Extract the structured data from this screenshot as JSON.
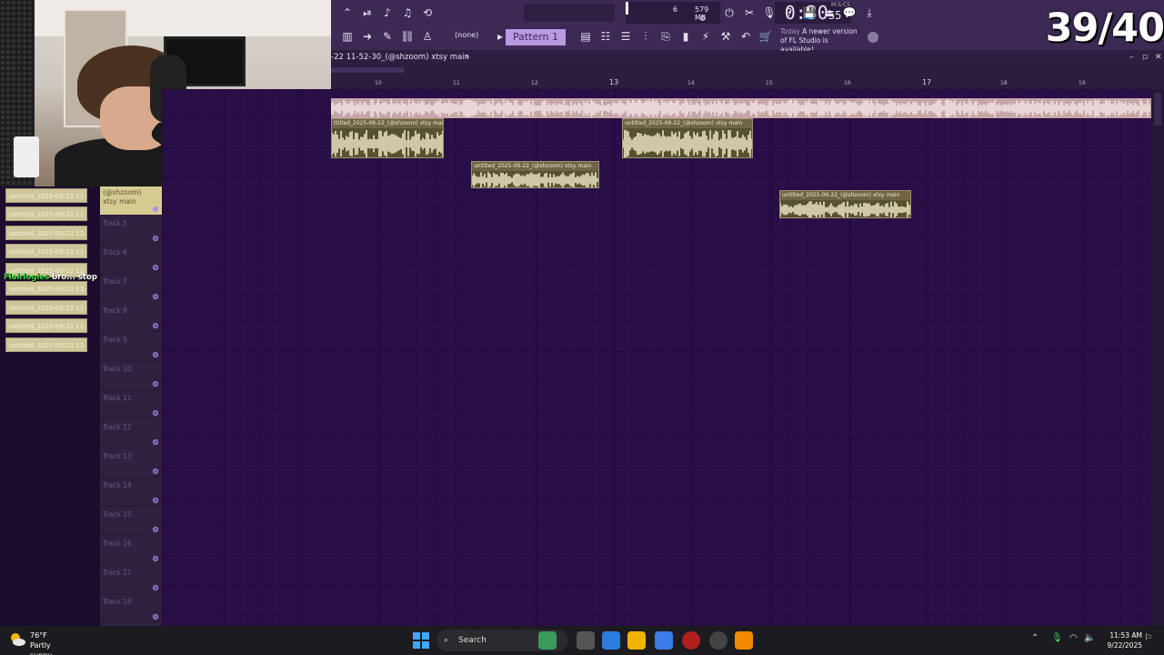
{
  "counter": "39/40",
  "toolbar": {
    "time_main": "0:30",
    "time_sub": "55",
    "time_unit": "M:S:CS",
    "cpu_value": "6",
    "ram_value": "579 MB",
    "voice_value": "0",
    "pattern_label": "Pattern 1",
    "snap_label": "(none)",
    "news_when": "Today",
    "news_text": "A newer version of FL Studio is available!"
  },
  "playlist": {
    "title": "-22 11-52-30_(@shzoom) xtsy main",
    "title_arrow": "›",
    "ruler": [
      "10",
      "11",
      "12",
      "13",
      "14",
      "15",
      "16",
      "17",
      "18",
      "19"
    ],
    "clips": [
      {
        "label": "ttitled_2025-09-22_(@shzoom) xtsy main"
      },
      {
        "label": "untitled_2025-09-22_(@shzoom) xtsy main"
      },
      {
        "label": "untitled_2025-09-22_(@shzoom) xtsy main"
      },
      {
        "label": "untitled_2025-09-22_(@shzoom) xtsy main"
      }
    ]
  },
  "browser": {
    "items": [
      "untitled_2025-09-22 11-",
      "untitled_2025-09-22 11-",
      "untitled_2025-09-22 11-",
      "untitled_2025-09-22 11-",
      "untitled_2025-09-22 11-",
      "untitled_2025-09-22 11-",
      "untitled_2025-09-22 11-",
      "untitled_2025-09-22 11-",
      "untitled_2025-09-22 11-"
    ]
  },
  "chat": {
    "user": "Flairlogies",
    "message": "bro... stop"
  },
  "tracks": {
    "active": "(@shzoom) xtsy main",
    "names": [
      "Track 5",
      "Track 6",
      "Track 7",
      "Track 8",
      "Track 9",
      "Track 10",
      "Track 11",
      "Track 12",
      "Track 13",
      "Track 14",
      "Track 15",
      "Track 16",
      "Track 17",
      "Track 18"
    ]
  },
  "taskbar": {
    "temp": "76°F",
    "weather": "Partly sunny",
    "search": "Search",
    "time": "11:53 AM",
    "date": "9/22/2025"
  },
  "colors": {
    "accent": "#b89ae0",
    "clip": "#e8e0b6",
    "grid": "#2a0e48"
  },
  "icons": [
    "metronome-icon",
    "record-icon",
    "undo-icon",
    "save-icon",
    "help-icon",
    "plugin-icon",
    "piano-roll-icon",
    "mixer-icon",
    "channel-rack-icon",
    "browser-icon",
    "windows-start-icon",
    "search-icon",
    "wifi-icon",
    "volume-icon",
    "battery-icon"
  ]
}
